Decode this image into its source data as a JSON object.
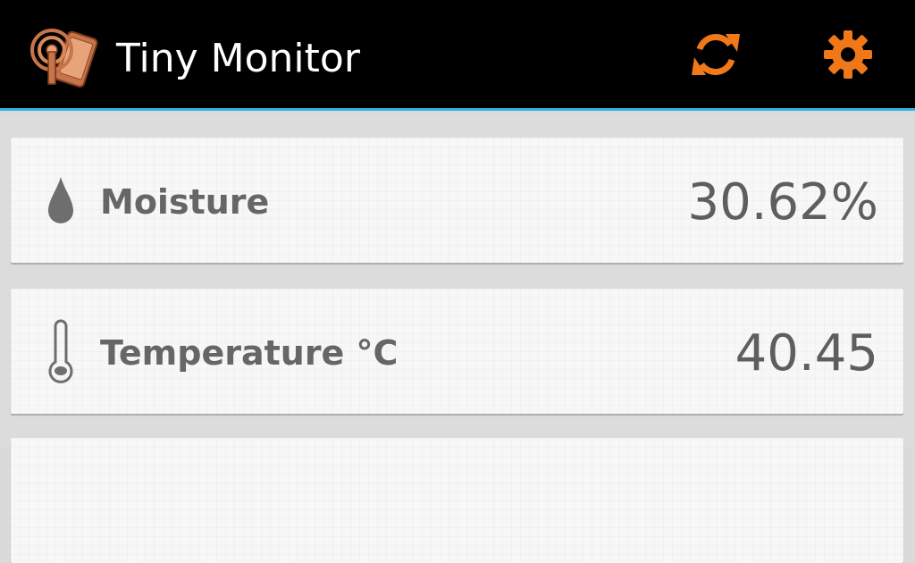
{
  "app": {
    "title": "Tiny Monitor",
    "icon": "phone-signal-app-icon",
    "accent_color": "#f07818",
    "bar_color": "#000000",
    "divider_color": "#33b5e5"
  },
  "actions": [
    {
      "name": "refresh",
      "icon": "refresh-icon"
    },
    {
      "name": "settings",
      "icon": "gear-icon"
    }
  ],
  "readings": [
    {
      "label": "Moisture",
      "value": "30.62%",
      "icon": "water-drop-icon"
    },
    {
      "label": "Temperature °C",
      "value": "40.45",
      "icon": "thermometer-icon"
    }
  ]
}
